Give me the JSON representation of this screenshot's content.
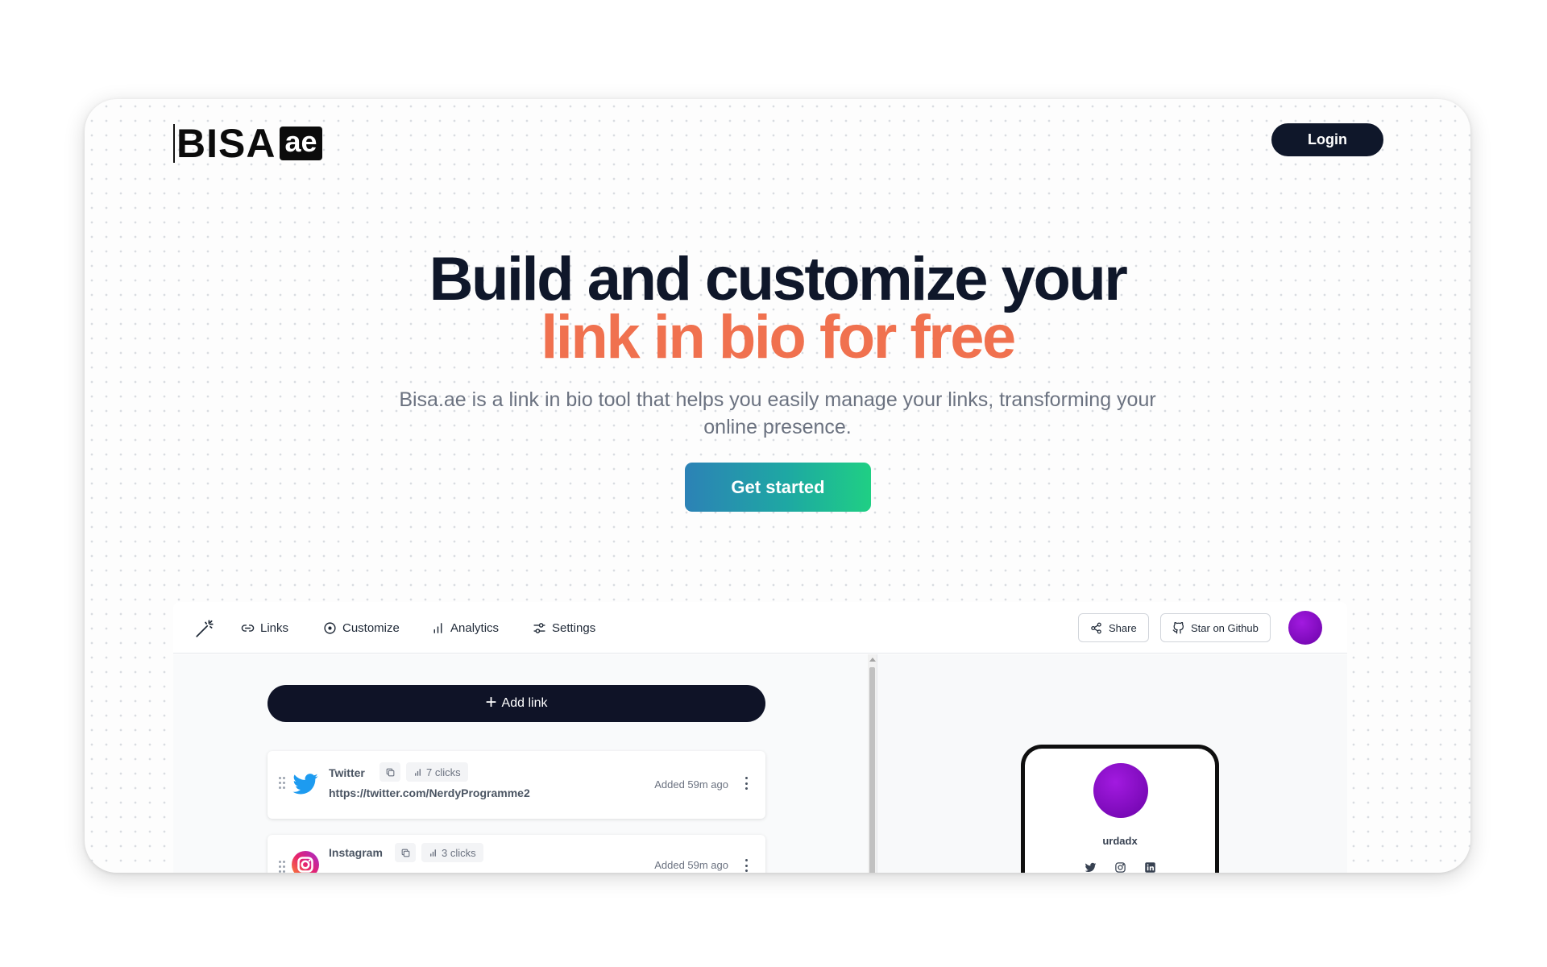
{
  "header": {
    "logo_text": "BISA",
    "logo_badge": "ae",
    "login_label": "Login"
  },
  "hero": {
    "title_line1": "Build and customize your",
    "title_line2": "link in bio for free",
    "subtitle": "Bisa.ae is a link in bio tool that helps you easily manage your links, transforming your online presence.",
    "cta_label": "Get started"
  },
  "colors": {
    "accent_orange": "#f0714f",
    "dark_navy": "#0f172a",
    "cta_gradient_start": "#2c82b6",
    "cta_gradient_end": "#1fcf84",
    "avatar_purple": "#8a0fd0"
  },
  "app": {
    "nav": {
      "logo_icon": "magic-wand-icon",
      "items": [
        {
          "label": "Links",
          "icon": "link-icon"
        },
        {
          "label": "Customize",
          "icon": "circle-icon"
        },
        {
          "label": "Analytics",
          "icon": "bar-chart-icon"
        },
        {
          "label": "Settings",
          "icon": "sliders-icon"
        }
      ],
      "share_label": "Share",
      "github_label": "Star on Github"
    },
    "add_link_label": "Add link",
    "links": [
      {
        "title": "Twitter",
        "clicks": "7 clicks",
        "url": "https://twitter.com/NerdyProgramme2",
        "added": "Added 59m ago",
        "icon": "twitter-icon"
      },
      {
        "title": "Instagram",
        "clicks": "3 clicks",
        "url": "",
        "added": "Added 59m ago",
        "icon": "instagram-icon"
      }
    ],
    "preview": {
      "username": "urdadx",
      "social_icons": [
        "twitter-icon",
        "instagram-icon",
        "linkedin-icon"
      ]
    }
  }
}
